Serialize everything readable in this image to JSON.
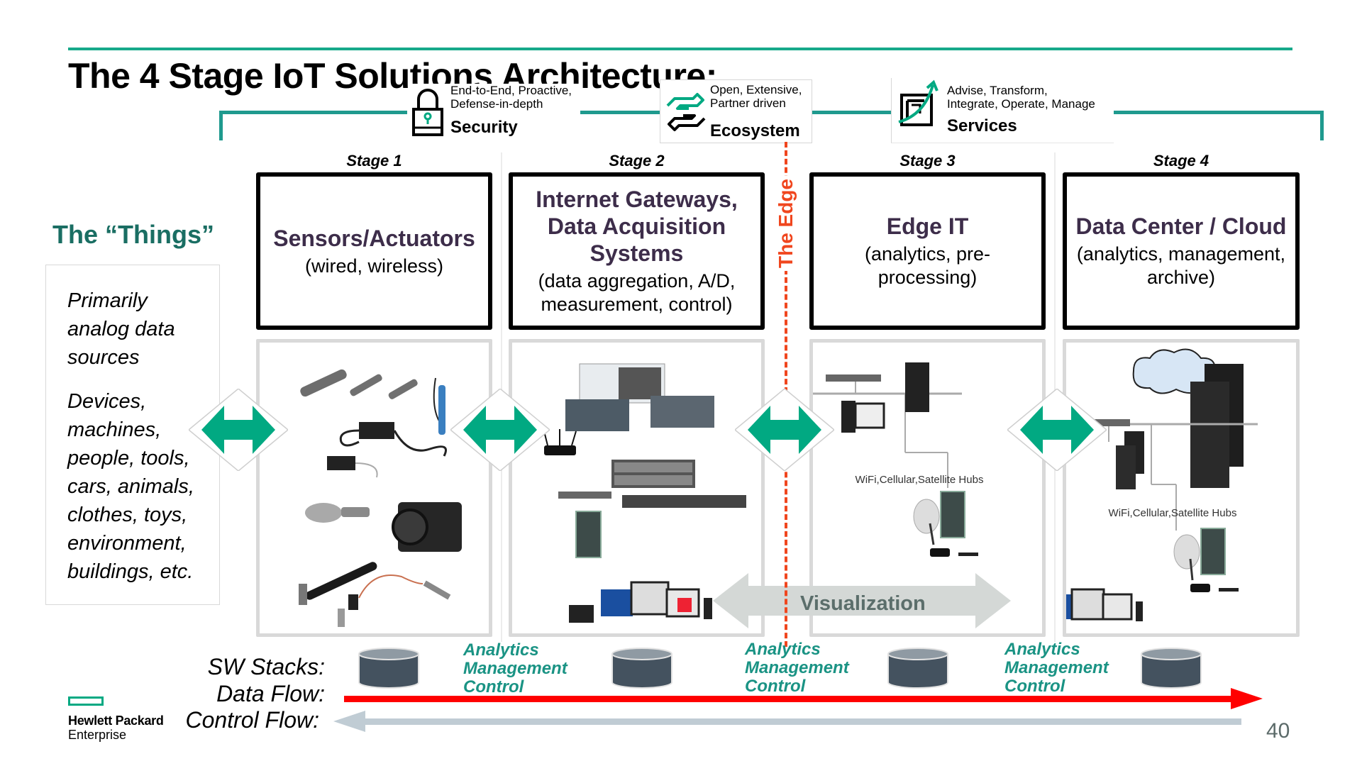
{
  "title": "The 4 Stage IoT Solutions Architecture:",
  "pillars": [
    {
      "name": "Security",
      "desc": [
        "End-to-End, Proactive,",
        "Defense-in-depth"
      ],
      "icon": "lock-icon"
    },
    {
      "name": "Ecosystem",
      "desc": [
        "Open, Extensive,",
        "Partner driven"
      ],
      "icon": "handshake-icon"
    },
    {
      "name": "Services",
      "desc": [
        "Advise, Transform,",
        "Integrate, Operate, Manage"
      ],
      "icon": "growth-arrow-icon"
    }
  ],
  "things": {
    "title": "The “Things”",
    "para1": "Primarily analog data sources",
    "para2": "Devices, machines, people, tools, cars, animals, clothes, toys, environment, buildings, etc."
  },
  "stages": [
    {
      "label": "Stage 1",
      "title": "Sensors/Actuators",
      "subtitle": "(wired, wireless)"
    },
    {
      "label": "Stage 2",
      "title": "Internet Gateways, Data Acquisition Systems",
      "subtitle": "(data aggregation, A/D, measurement, control)"
    },
    {
      "label": "Stage 3",
      "title": "Edge IT",
      "subtitle": "(analytics, pre-processing)"
    },
    {
      "label": "Stage 4",
      "title": "Data Center / Cloud",
      "subtitle": "(analytics, management, archive)"
    }
  ],
  "edge_label": "The Edge",
  "panel_captions": {
    "stage3_hubs": "WiFi,Cellular,Satellite Hubs",
    "stage4_hubs": "WiFi,Cellular,Satellite Hubs"
  },
  "visualization_label": "Visualization",
  "rows": {
    "sw_stacks": "SW Stacks:",
    "data_flow": "Data Flow:",
    "control_flow": "Control Flow:"
  },
  "amc_blocks": [
    [
      "Analytics",
      "Management",
      "Control"
    ],
    [
      "Analytics",
      "Management",
      "Control"
    ],
    [
      "Analytics",
      "Management",
      "Control"
    ]
  ],
  "brand": {
    "line1": "Hewlett Packard",
    "line2": "Enterprise"
  },
  "page_number": "40",
  "colors": {
    "accent_teal": "#1f9a8e",
    "hpe_green": "#01a982",
    "edge_orange": "#f0461e",
    "data_flow_red": "#ff0000",
    "control_flow_gray": "#c0ccd4",
    "stage_title": "#3d2d4a"
  }
}
